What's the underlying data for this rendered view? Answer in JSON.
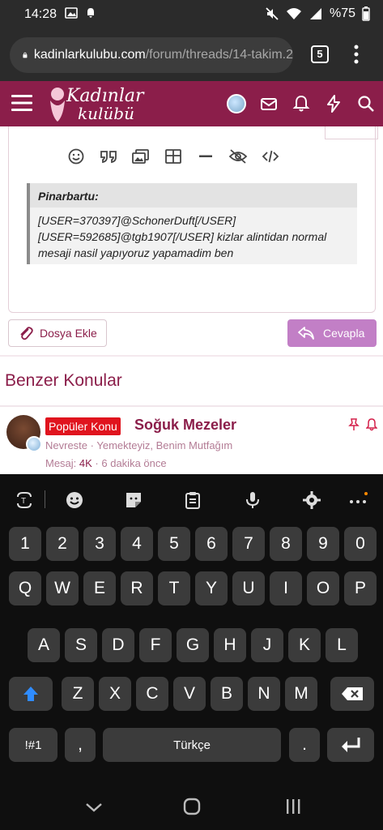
{
  "status_bar": {
    "time": "14:28",
    "battery": "%75",
    "icons": [
      "image-icon",
      "notification-icon",
      "mute-icon",
      "wifi-icon",
      "signal-icon"
    ]
  },
  "browser": {
    "url_host": "kadinlarkulubu.com",
    "url_path": "/forum/threads/14-takim.2",
    "tab_count": "5"
  },
  "site_header": {
    "logo_line1": "Kadınlar",
    "logo_line2": "kulübü",
    "brand_color": "#8b1e4a"
  },
  "quote": {
    "author": "Pinarbartu:",
    "lines": [
      "[USER=370397]@SchonerDuft[/USER]",
      "[USER=592685]@tgb1907[/USER] kizlar alintidan normal",
      "mesaji nasil yapıyoruz yapamadim ben"
    ]
  },
  "actions": {
    "attach_label": "Dosya Ekle",
    "reply_label": "Cevapla"
  },
  "similar": {
    "title": "Benzer Konular",
    "thread": {
      "badge": "Popüler Konu",
      "title": "Soğuk Mezeler",
      "author": "Nevreste",
      "sep": " · ",
      "forum": "Yemekteyiz, Benim Mutfağım",
      "stats_label": "Mesaj: ",
      "stats_value": "4K",
      "time": "6 dakika önce"
    }
  },
  "keyboard": {
    "row_numbers": [
      "1",
      "2",
      "3",
      "4",
      "5",
      "6",
      "7",
      "8",
      "9",
      "0"
    ],
    "row_q": [
      "Q",
      "W",
      "E",
      "R",
      "T",
      "Y",
      "U",
      "I",
      "O",
      "P"
    ],
    "row_a": [
      "A",
      "S",
      "D",
      "F",
      "G",
      "H",
      "J",
      "K",
      "L"
    ],
    "row_z": [
      "Z",
      "X",
      "C",
      "V",
      "B",
      "N",
      "M"
    ],
    "symbols_key": "!#1",
    "comma_key": ",",
    "space_label": "Türkçe",
    "period_key": "."
  }
}
